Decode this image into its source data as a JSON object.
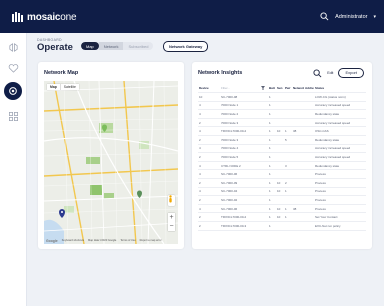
{
  "header": {
    "brand_bold": "mosaic",
    "brand_light": "one",
    "user": "Administrator"
  },
  "page": {
    "eyebrow": "DASHBOARD",
    "title": "Operate"
  },
  "view_tabs": {
    "map": "Map",
    "network": "Network",
    "subscribed": "Subscribed"
  },
  "gateway_button": "Network Gateway",
  "map_card": {
    "title": "Network Map",
    "map_label": "Map",
    "satellite_label": "Satellite",
    "google": "Google",
    "footer": [
      "Keyboard shortcuts",
      "Map data ©2023 Google",
      "Terms of Use",
      "Report a map error"
    ]
  },
  "insights": {
    "title": "Network Insights",
    "edit_label": "Edit",
    "export_label": "Export",
    "columns": [
      "Device",
      "Node",
      "Batt",
      "Sen",
      "Pwr",
      "Network",
      "Address",
      "Status"
    ],
    "filter_hint": "Filter...",
    "rows": [
      [
        "10",
        "SC-7000-08",
        "1",
        "",
        "",
        "",
        "",
        "LOW-CG (status norm)"
      ],
      [
        "4",
        "7000 Node 1",
        "1",
        "",
        "",
        "",
        "",
        "Accuracy increased speed"
      ],
      [
        "4",
        "7000 Node 2",
        "1",
        "",
        "",
        "",
        "",
        "Redundancy state"
      ],
      [
        "2",
        "7000 Node 3",
        "1",
        "",
        "",
        "",
        "",
        "Accuracy increased speed"
      ],
      [
        "4",
        "TRIXICL7000-00-2",
        "1",
        "10",
        "1",
        "38",
        "",
        "OSC-CAS"
      ],
      [
        "2",
        "7000 Node 3",
        "1",
        "",
        "5",
        "",
        "",
        "Redundancy state"
      ],
      [
        "4",
        "7000 Node 4",
        "1",
        "",
        "",
        "",
        "",
        "Accuracy increased speed"
      ],
      [
        "2",
        "7000 Node 5",
        "1",
        "",
        "",
        "",
        "",
        "Accuracy increased speed"
      ],
      [
        "4",
        "CTRL NODE 2",
        "1",
        "",
        "3",
        "",
        "",
        "Redundancy state"
      ],
      [
        "4",
        "SC-7000-06",
        "1",
        "",
        "",
        "",
        "",
        "Process"
      ],
      [
        "2",
        "SC-7000-09",
        "1",
        "10",
        "2",
        "",
        "",
        "Process"
      ],
      [
        "4",
        "SC-7000-04",
        "1",
        "10",
        "1",
        "",
        "",
        "Process"
      ],
      [
        "2",
        "SC-7000-02",
        "1",
        "",
        "",
        "",
        "",
        "Process"
      ],
      [
        "4",
        "SC-7000-06",
        "1",
        "10",
        "1",
        "38",
        "",
        "Process"
      ],
      [
        "2",
        "TRIXICL7000-00-2",
        "1",
        "10",
        "1",
        "",
        "",
        "Set Your Contact"
      ],
      [
        "2",
        "TRIXICL7000-00-3",
        "1",
        "",
        "",
        "",
        "",
        "EXC-Net run policy"
      ]
    ]
  },
  "colors": {
    "navy": "#0f1d47",
    "accent_green": "#7cbd5c"
  }
}
